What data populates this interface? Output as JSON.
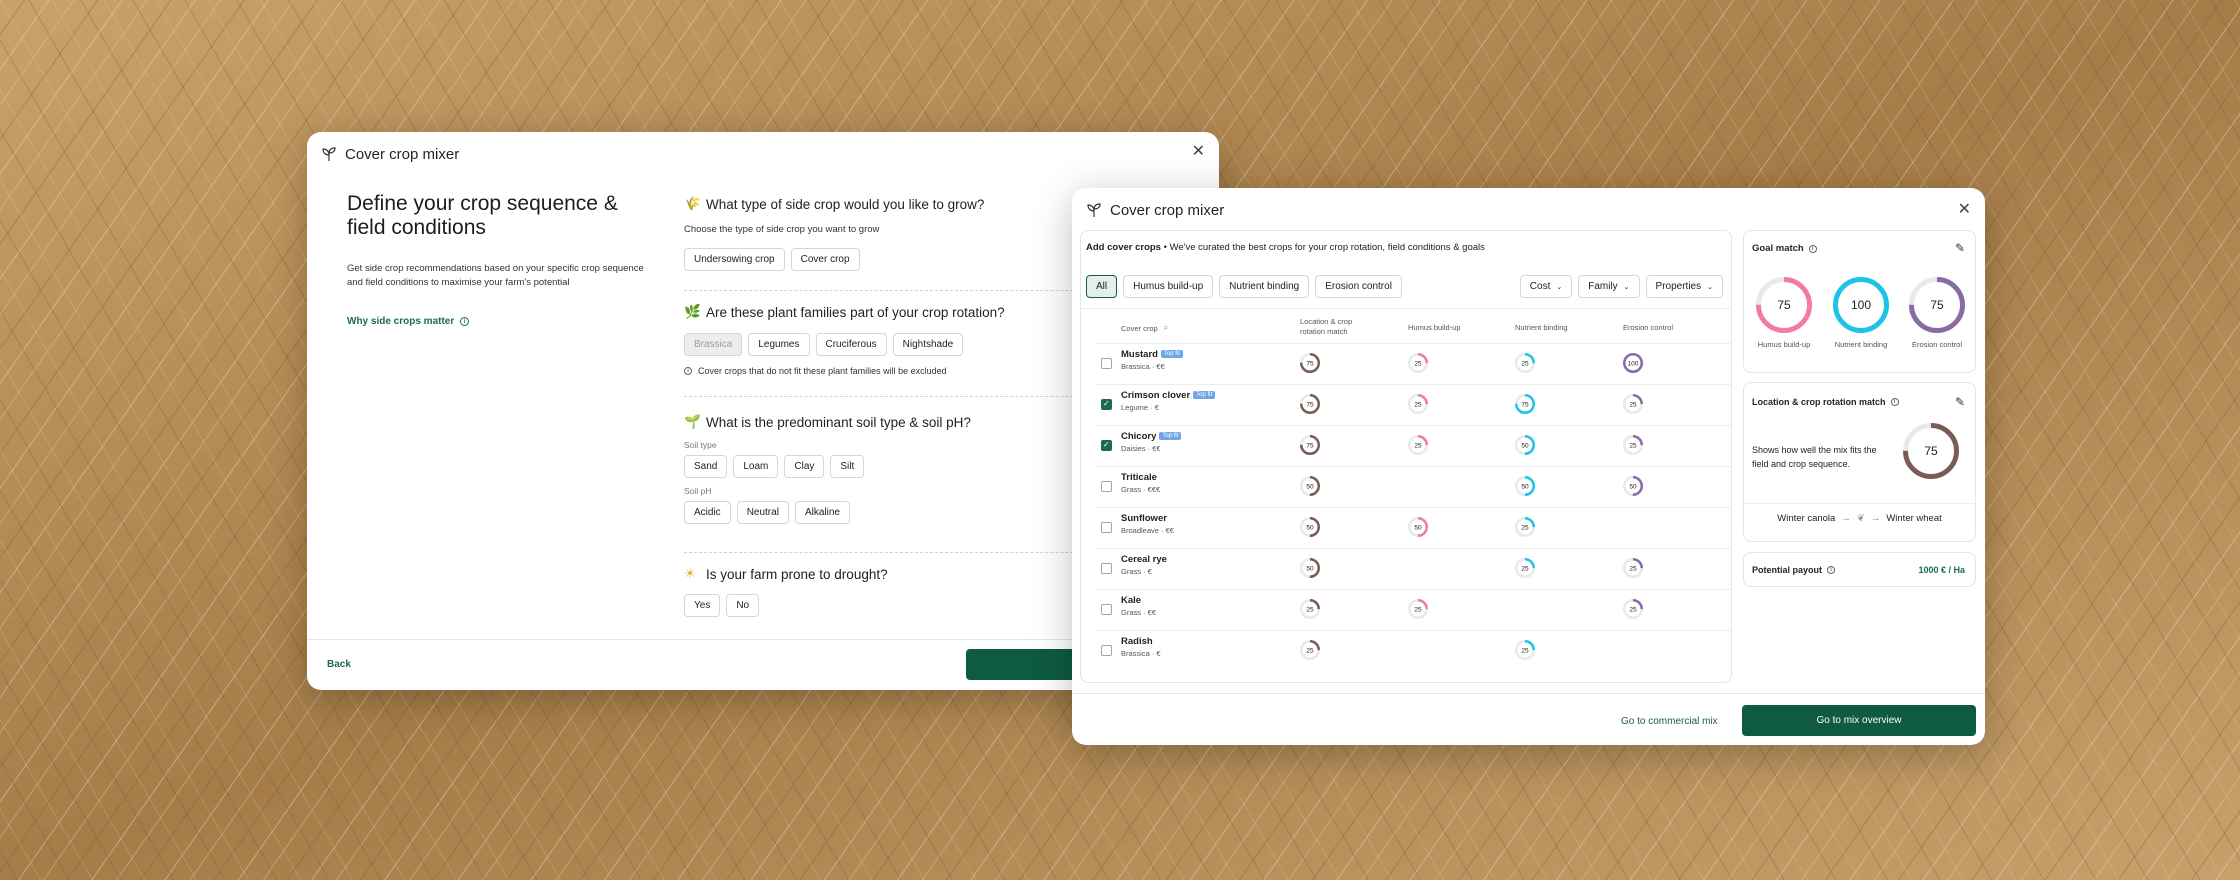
{
  "left_modal": {
    "title": "Cover crop mixer",
    "heading": "Define your crop sequence & field conditions",
    "description": "Get side crop recommendations based on your specific crop sequence and field conditions to maximise your farm's potential",
    "why_link": "Why side crops matter",
    "q1": {
      "title": "What type of side crop would you like to grow?",
      "sub": "Choose the type of side crop you want to grow",
      "options": [
        "Undersowing crop",
        "Cover crop"
      ]
    },
    "q2": {
      "title": "Are these plant families part of your crop rotation?",
      "options": [
        "Brassica",
        "Legumes",
        "Cruciferous",
        "Nightshade"
      ],
      "note": "Cover crops that do not fit these plant families will be excluded"
    },
    "q3": {
      "title": "What is the predominant soil type & soil pH?",
      "soil_type_label": "Soil type",
      "soil_types": [
        "Sand",
        "Loam",
        "Clay",
        "Silt"
      ],
      "soil_ph_label": "Soil pH",
      "soil_phs": [
        "Acidic",
        "Neutral",
        "Alkaline"
      ]
    },
    "q4": {
      "title": "Is your farm prone to drought?",
      "options": [
        "Yes",
        "No"
      ]
    },
    "back": "Back"
  },
  "right_modal": {
    "title": "Cover crop mixer",
    "add_title": "Add cover crops",
    "add_sub": "We've curated the best crops for your crop rotation, field conditions & goals",
    "filters": [
      "All",
      "Humus build-up",
      "Nutrient binding",
      "Erosion control"
    ],
    "dropdowns": [
      "Cost",
      "Family",
      "Properties"
    ],
    "columns": [
      "Cover crop",
      "Location & crop rotation match",
      "Humus build-up",
      "Nutrient binding",
      "Erosion control"
    ],
    "top_fit": "Top fit",
    "rows": [
      {
        "name": "Mustard",
        "meta": "Brassica · €€",
        "top": true,
        "checked": false,
        "loc": 75,
        "humus": 25,
        "nutrient": 25,
        "erosion": 100
      },
      {
        "name": "Crimson clover",
        "meta": "Legume · €",
        "top": true,
        "checked": true,
        "loc": 75,
        "humus": 25,
        "nutrient": 75,
        "erosion": 25
      },
      {
        "name": "Chicory",
        "meta": "Daisies · €€",
        "top": true,
        "checked": true,
        "loc": 75,
        "humus": 25,
        "nutrient": 50,
        "erosion": 25
      },
      {
        "name": "Triticale",
        "meta": "Grass · €€€",
        "top": false,
        "checked": false,
        "loc": 50,
        "humus": null,
        "nutrient": 50,
        "erosion": 50
      },
      {
        "name": "Sunflower",
        "meta": "Broadleave · €€",
        "top": false,
        "checked": false,
        "loc": 50,
        "humus": 50,
        "nutrient": 25,
        "erosion": null
      },
      {
        "name": "Cereal rye",
        "meta": "Grass · €",
        "top": false,
        "checked": false,
        "loc": 50,
        "humus": null,
        "nutrient": 25,
        "erosion": 25
      },
      {
        "name": "Kale",
        "meta": "Grass · €€",
        "top": false,
        "checked": false,
        "loc": 25,
        "humus": 25,
        "nutrient": null,
        "erosion": 25
      },
      {
        "name": "Radish",
        "meta": "Brassica · €",
        "top": false,
        "checked": false,
        "loc": 25,
        "humus": null,
        "nutrient": 25,
        "erosion": null
      }
    ],
    "goal_match": {
      "title": "Goal match",
      "items": [
        {
          "value": 75,
          "label": "Humus build-up",
          "color": "#f27aa8"
        },
        {
          "value": 100,
          "label": "Nutrient binding",
          "color": "#1ec3e8"
        },
        {
          "value": 75,
          "label": "Erosion control",
          "color": "#8b6aa8"
        }
      ]
    },
    "location_match": {
      "title": "Location & crop rotation match",
      "desc": "Shows how well the mix fits the field and crop sequence.",
      "value": 75,
      "from": "Winter canola",
      "to": "Winter wheat",
      "color": "#7a5c55"
    },
    "payout": {
      "title": "Potential payout",
      "value": "1000 € / Ha"
    },
    "commercial": "Go to commercial mix",
    "overview": "Go to mix overview"
  },
  "colors": {
    "humus": "#f27aa8",
    "nutrient": "#1ec3e8",
    "erosion": "#8b6aa8",
    "location": "#7a5c55",
    "brand": "#0e5a43"
  }
}
